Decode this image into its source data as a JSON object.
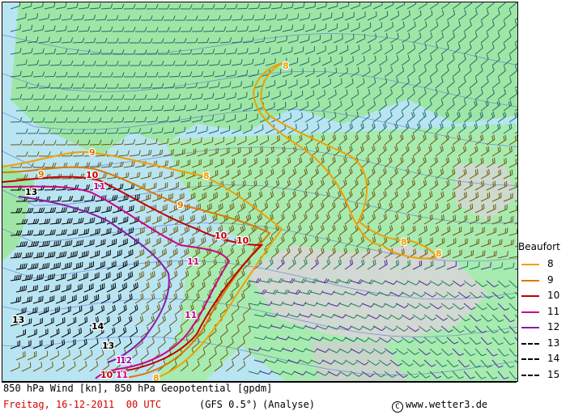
{
  "map": {
    "contour_labels": [
      "8",
      "8",
      "8",
      "8",
      "8",
      "9",
      "9",
      "9",
      "10",
      "10",
      "10",
      "10",
      "11",
      "11",
      "11",
      "11",
      "11",
      "12",
      "13",
      "13",
      "13",
      "14"
    ],
    "colors": {
      "land": "#9fe6a6",
      "sea": "#b9e4f2",
      "mountain": "#cfcfcf",
      "bf8": "#f0a000",
      "bf9": "#d97a00",
      "bf10": "#c00000",
      "bf11": "#cc0088",
      "bf12": "#8a1aa8",
      "bf13": "#000000"
    },
    "barb_icon": "wind-barb-icon"
  },
  "legend": {
    "title": "Beaufort",
    "items": [
      {
        "label": "8",
        "color": "#f0a000",
        "style": "solid"
      },
      {
        "label": "9",
        "color": "#d97a00",
        "style": "solid"
      },
      {
        "label": "10",
        "color": "#c00000",
        "style": "solid"
      },
      {
        "label": "11",
        "color": "#cc0088",
        "style": "solid"
      },
      {
        "label": "12",
        "color": "#8a1aa8",
        "style": "solid"
      },
      {
        "label": "13",
        "color": "#000000",
        "style": "dashed"
      },
      {
        "label": "14",
        "color": "#000000",
        "style": "dashed"
      },
      {
        "label": "15",
        "color": "#000000",
        "style": "dashed"
      }
    ]
  },
  "footer": {
    "line1": "850 hPa Wind [kn], 850 hPa Geopotential [gpdm]",
    "date": "Freitag, 16-12-2011  00 UTC",
    "model": "(GFS 0.5°)",
    "kind": "(Analyse)",
    "copyright_symbol": "C",
    "copyright": "www.wetter3.de"
  }
}
